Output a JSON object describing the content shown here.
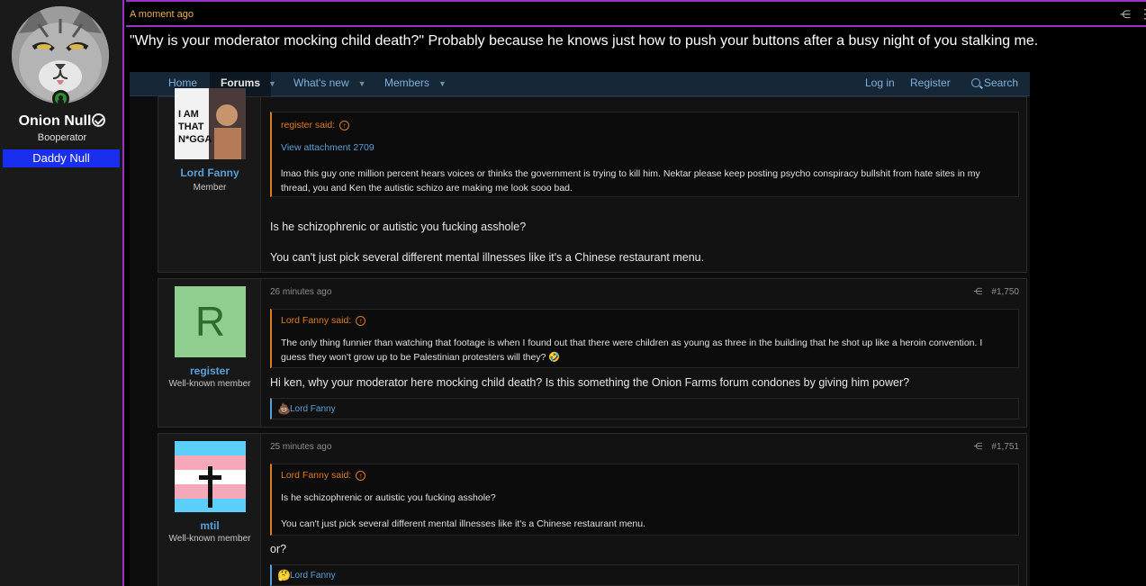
{
  "profile": {
    "name": "Onion Null",
    "role": "Booperator",
    "badge": "Daddy Null"
  },
  "banner": {
    "time": "A moment ago",
    "headline": "\"Why is your moderator mocking child death?\" Probably because he knows just how to push your buttons after a busy night of you stalking me."
  },
  "nav": {
    "home": "Home",
    "forums": "Forums",
    "whats_new": "What's new",
    "members": "Members",
    "login": "Log in",
    "register": "Register",
    "search": "Search"
  },
  "posts": [
    {
      "username": "Lord Fanny",
      "usertitle": "Member",
      "avatar_text": "I AM THAT N*GGA",
      "quote_author": "register said:",
      "quote_link": "View attachment 2709",
      "quote_text": "lmao this guy one million percent hears voices or thinks the government is trying to kill him. Nektar please keep posting psycho conspiracy bullshit from hate sites in my thread, you and Ken the autistic schizo are making me look sooo bad.",
      "text1": "Is he schizophrenic or autistic you fucking asshole?",
      "text2": "You can't just pick several different mental illnesses like it's a Chinese restaurant menu."
    },
    {
      "time": "26 minutes ago",
      "number": "#1,750",
      "username": "register",
      "usertitle": "Well-known member",
      "avatar_letter": "R",
      "quote_author": "Lord Fanny said:",
      "quote_text": "The only thing funnier than watching that footage is when I found out that there were children as young as three in the building that he shot up like a heroin convention. I guess they won't grow up to be Palestinian protesters will they? 🤣",
      "text1": "Hi ken, why your moderator here mocking child death? Is this something the Onion Farms forum condones by giving him power?",
      "reaction_icon": "💩",
      "reaction_user": "Lord Fanny"
    },
    {
      "time": "25 minutes ago",
      "number": "#1,751",
      "username": "mtil",
      "usertitle": "Well-known member",
      "quote_author": "Lord Fanny said:",
      "quote_line1": "Is he schizophrenic or autistic you fucking asshole?",
      "quote_line2": "You can't just pick several different mental illnesses like it's a Chinese restaurant menu.",
      "text1": "or?",
      "reaction_icon": "🤔",
      "reaction_user": "Lord Fanny"
    }
  ],
  "colors": {
    "accent_purple": "#9b35c7",
    "link_blue": "#5a9fd8",
    "quote_orange": "#e07a1f",
    "badge_blue": "#1a2ef0"
  }
}
